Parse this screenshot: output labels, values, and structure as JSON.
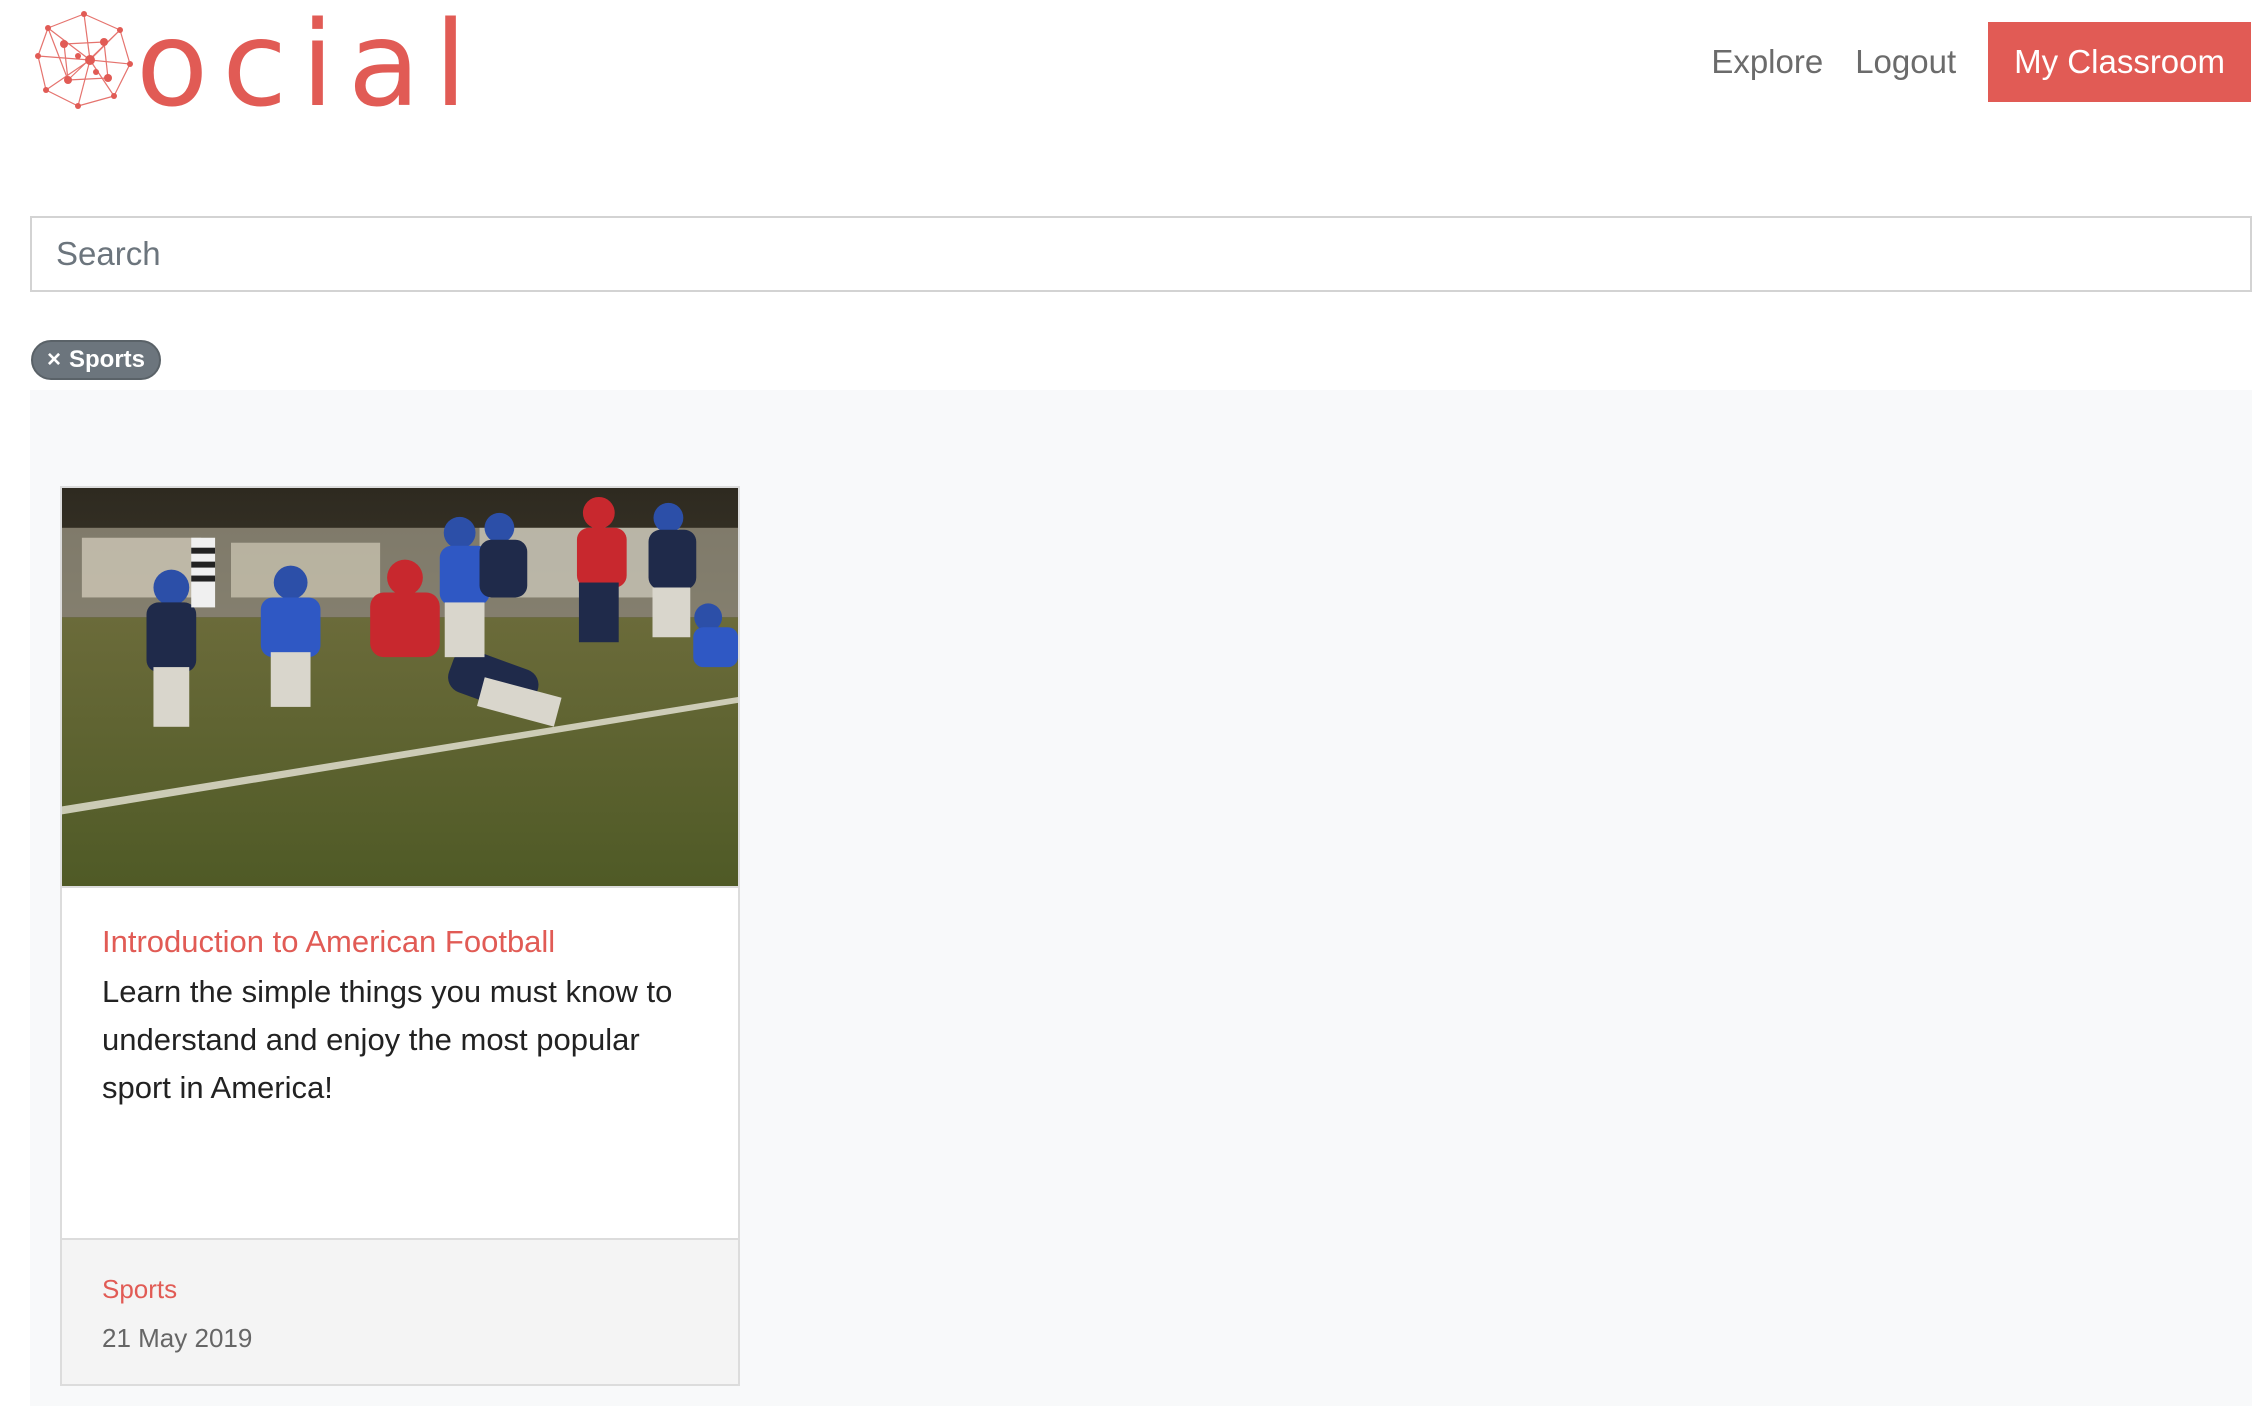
{
  "brand": {
    "logo_text": "ocial",
    "accent_color": "#e15b55"
  },
  "nav": {
    "explore_label": "Explore",
    "logout_label": "Logout",
    "classroom_label": "My Classroom"
  },
  "search": {
    "placeholder": "Search",
    "value": ""
  },
  "filter": {
    "remove_icon": "×",
    "label": "Sports"
  },
  "results": [
    {
      "image_alt": "football-photo",
      "title": "Introduction to American Football",
      "description": "Learn the simple things you must know to understand and enjoy the most popular sport in America!",
      "category": "Sports",
      "date": "21 May 2019"
    }
  ]
}
